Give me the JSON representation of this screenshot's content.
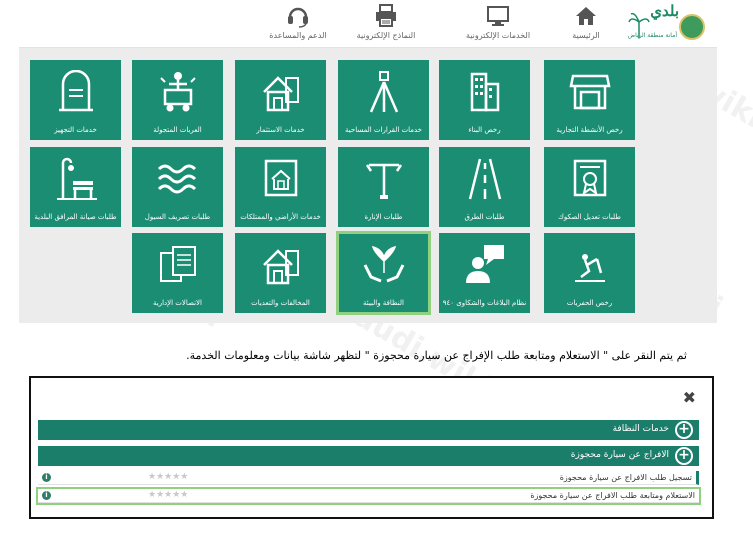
{
  "navbar": {
    "items": [
      {
        "label": "الرئيسية",
        "icon": "home-icon"
      },
      {
        "label": "الخدمات الإلكترونية",
        "icon": "monitor-icon"
      },
      {
        "label": "النماذج الإلكترونية",
        "icon": "printer-icon"
      },
      {
        "label": "الدعم والمساعدة",
        "icon": "headset-icon"
      }
    ],
    "logo": {
      "title": "بلدي",
      "subtitle": "أمانة منطقة الرياض"
    }
  },
  "tiles": [
    {
      "label": "رخص الأنشطة التجارية",
      "icon": "shop-icon"
    },
    {
      "label": "رخص البناء",
      "icon": "building-icon"
    },
    {
      "label": "خدمات القرارات المساحية",
      "icon": "survey-tripod-icon"
    },
    {
      "label": "خدمات الاستثمار",
      "icon": "house-investment-icon"
    },
    {
      "label": "العربات المتجولة",
      "icon": "food-cart-icon"
    },
    {
      "label": "خدمات التجهيز",
      "icon": "tombstone-icon"
    },
    {
      "label": "طلبات تعديل الصكوك",
      "icon": "certificate-icon"
    },
    {
      "label": "طلبات الطرق",
      "icon": "road-icon"
    },
    {
      "label": "طلبات الإنارة",
      "icon": "street-light-icon"
    },
    {
      "label": "خدمات الأراضي والممتلكات",
      "icon": "blueprint-icon"
    },
    {
      "label": "طلبات تصريف السيول",
      "icon": "waves-icon"
    },
    {
      "label": "طلبات صيانة المرافق البلدية",
      "icon": "park-bench-icon"
    },
    {
      "label": "رخص الحفريات",
      "icon": "excavation-icon"
    },
    {
      "label": "نظام البلاغات والشكاوى ٩٤٠",
      "icon": "complaint-icon"
    },
    {
      "label": "النظافة والبيئة",
      "icon": "hands-plant-icon"
    },
    {
      "label": "المخالفات والتعديات",
      "icon": "violation-house-icon"
    },
    {
      "label": "الاتصالات الإدارية",
      "icon": "documents-icon"
    }
  ],
  "instruction": "ثم يتم النقر على \" الاستعلام ومتابعة طلب الإفراج عن سيارة محجوزة \" لتظهر شاشة بيانات ومعلومات الخدمة.",
  "panel": {
    "close_symbol": "✖",
    "category": "خدمات النظافة",
    "subcategory": "الافراج عن سيارة محجوزة",
    "services": [
      {
        "label": "تسجيل طلب الافراج عن سيارة محجوزة",
        "rating": "★★★★★",
        "info": "i"
      },
      {
        "label": "الاستعلام ومتابعة طلب الافراج عن سيارة محجوزة",
        "rating": "★★★★★",
        "info": "i"
      }
    ]
  },
  "watermark": "saudi.wiki"
}
